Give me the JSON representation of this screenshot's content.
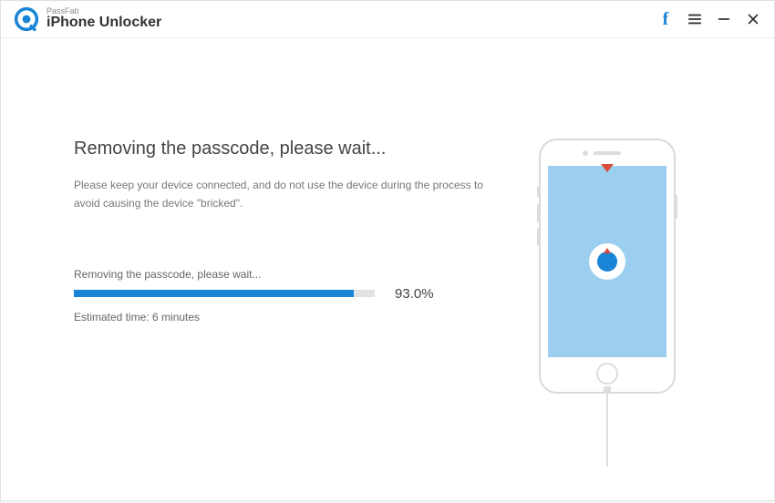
{
  "titlebar": {
    "brand_small": "PassFab",
    "brand_large": "iPhone Unlocker"
  },
  "main": {
    "heading": "Removing the passcode, please wait...",
    "subtext": "Please keep your device connected, and do not use the device during the process to avoid causing the device \"bricked\".",
    "progress_label": "Removing the passcode, please wait...",
    "progress_percent_text": "93.0%",
    "progress_percent_value": 93,
    "eta": "Estimated time: 6 minutes"
  },
  "colors": {
    "accent": "#1a84d6"
  }
}
